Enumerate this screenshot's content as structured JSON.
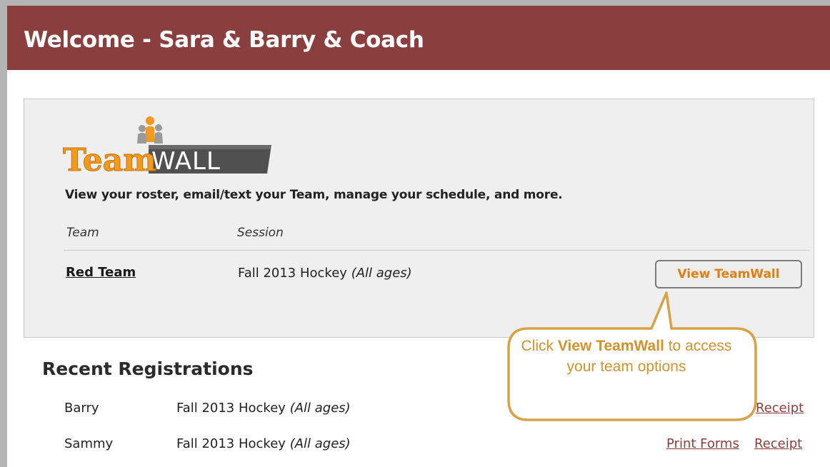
{
  "header": {
    "title": "Welcome - Sara & Barry & Coach"
  },
  "teamwall": {
    "logo_text_team": "Team",
    "logo_text_wall": "WALL",
    "tagline": "View your roster, email/text your Team, manage your schedule, and more.",
    "columns": {
      "team": "Team",
      "session": "Session"
    },
    "rows": [
      {
        "team": "Red Team",
        "session": "Fall 2013 Hockey",
        "age": "(All ages)",
        "button": "View TeamWall"
      }
    ]
  },
  "recent": {
    "title": "Recent Registrations",
    "rows": [
      {
        "name": "Barry",
        "session": "Fall 2013 Hockey",
        "age": "(All ages)",
        "links": [
          "Receipt"
        ]
      },
      {
        "name": "Sammy",
        "session": "Fall 2013 Hockey",
        "age": "(All ages)",
        "links": [
          "Print Forms",
          "Receipt"
        ]
      }
    ]
  },
  "callout": {
    "prefix": "Click ",
    "bold": "View TeamWall",
    "suffix": " to access your team options"
  },
  "colors": {
    "header_bg": "#8b3e3e",
    "button_text": "#e07f12",
    "callout": "#d4932a",
    "link": "#8b3e3e"
  }
}
